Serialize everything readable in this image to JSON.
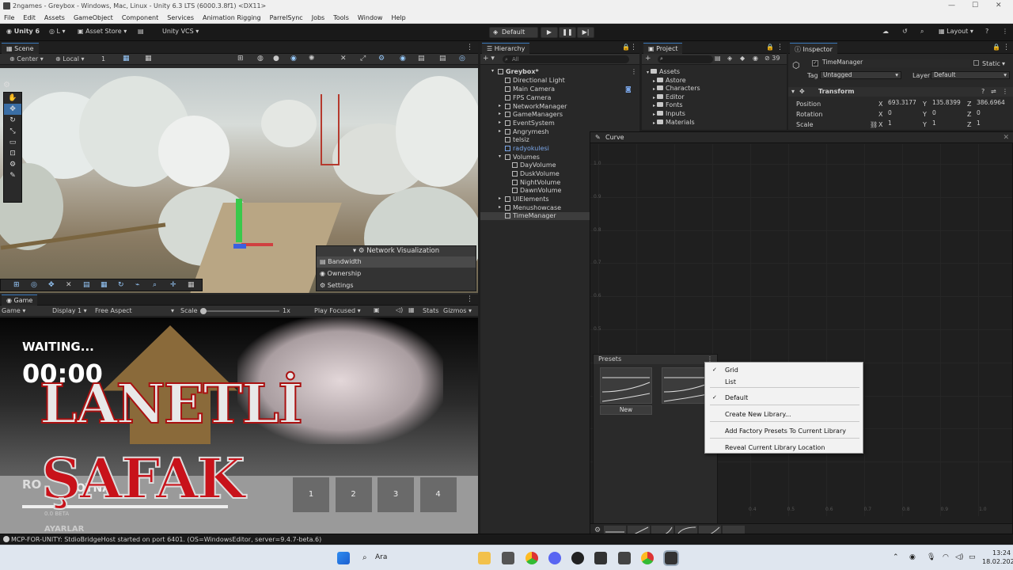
{
  "window": {
    "title": "2ngames - Greybox - Windows, Mac, Linux - Unity 6.3 LTS (6000.3.8f1) <DX11>",
    "minimize": "—",
    "maximize": "☐",
    "close": "✕"
  },
  "menu": [
    "File",
    "Edit",
    "Assets",
    "GameObject",
    "Component",
    "Services",
    "Animation Rigging",
    "ParrelSync",
    "Jobs",
    "Tools",
    "Window",
    "Help"
  ],
  "toolbar": {
    "unity_label": "Unity 6",
    "account": "L",
    "asset_store": "Asset Store",
    "vcs": "Unity VCS",
    "default_label": "Default",
    "layout": "Layout"
  },
  "scene": {
    "tab": "Scene",
    "pivot": "Center",
    "space": "Local",
    "snap_value": "1",
    "overlay": {
      "title": "Network Visualization",
      "items": [
        "Bandwidth",
        "Ownership",
        "Settings"
      ]
    }
  },
  "game": {
    "tab": "Game",
    "mode": "Game",
    "display": "Display 1",
    "aspect": "Free Aspect",
    "scale_label": "Scale",
    "scale_value": "1x",
    "play_mode": "Play Focused",
    "stats": "Stats",
    "gizmos": "Gizmos",
    "waiting": "WAITING...",
    "timer": "00:00",
    "title_line1": "LANETLİ",
    "title_line2": "ŞAFAK",
    "play": "OYNA",
    "role_partial": "RO",
    "settings_partial": "AYARLAR",
    "version_partial": "0.0 BETA",
    "buttons": [
      "1",
      "2",
      "3",
      "4"
    ]
  },
  "hierarchy": {
    "tab": "Hierarchy",
    "search_placeholder": "All",
    "items": [
      {
        "label": "Greybox*",
        "depth": 0
      },
      {
        "label": "Directional Light",
        "depth": 1
      },
      {
        "label": "Main Camera",
        "depth": 1
      },
      {
        "label": "FPS Camera",
        "depth": 1
      },
      {
        "label": "NetworkManager",
        "depth": 1
      },
      {
        "label": "GameManagers",
        "depth": 1
      },
      {
        "label": "EventSystem",
        "depth": 1
      },
      {
        "label": "Angrymesh",
        "depth": 1
      },
      {
        "label": "telsiz",
        "depth": 1
      },
      {
        "label": "radyokulesi",
        "depth": 1
      },
      {
        "label": "Volumes",
        "depth": 1
      },
      {
        "label": "DayVolume",
        "depth": 2
      },
      {
        "label": "DuskVolume",
        "depth": 2
      },
      {
        "label": "NightVolume",
        "depth": 2
      },
      {
        "label": "DawnVolume",
        "depth": 2
      },
      {
        "label": "UIElements",
        "depth": 1
      },
      {
        "label": "Menushowcase",
        "depth": 1
      },
      {
        "label": "TimeManager",
        "depth": 1
      }
    ]
  },
  "project": {
    "tab": "Project",
    "count": "39",
    "items": [
      "Assets",
      "Astore",
      "Characters",
      "Editor",
      "Fonts",
      "Inputs",
      "Materials"
    ]
  },
  "inspector": {
    "tab": "Inspector",
    "object_name": "TimeManager",
    "static": "Static",
    "tag_label": "Tag",
    "tag_value": "Untagged",
    "layer_label": "Layer",
    "layer_value": "Default",
    "component": "Transform",
    "position_label": "Position",
    "rotation_label": "Rotation",
    "scale_label": "Scale",
    "position": {
      "x": "693.3177",
      "y": "135.8399",
      "z": "386.6964"
    },
    "rotation": {
      "x": "0",
      "y": "0",
      "z": "0"
    },
    "scale": {
      "x": "1",
      "y": "1",
      "z": "1"
    },
    "axis": {
      "x": "X",
      "y": "Y",
      "z": "Z"
    }
  },
  "curve": {
    "title": "Curve",
    "y_ticks": [
      "1.0",
      "0.9",
      "0.8",
      "0.7",
      "0.6",
      "0.5",
      "0.4",
      "0.3",
      "0.2",
      "0.1"
    ],
    "x_ticks": [
      "0.4",
      "0.5",
      "0.6",
      "0.7",
      "0.8",
      "0.9",
      "1.0"
    ],
    "presets_title": "Presets",
    "new_label": "New"
  },
  "context_menu": {
    "items": [
      {
        "label": "Grid",
        "checked": true
      },
      {
        "label": "List",
        "checked": false
      },
      {
        "label": "Default",
        "checked": true
      },
      {
        "label": "Create New Library...",
        "checked": false
      },
      {
        "label": "Add Factory Presets To Current Library",
        "checked": false
      },
      {
        "label": "Reveal Current Library Location",
        "checked": false
      }
    ],
    "check_glyph": "✓"
  },
  "status": {
    "text": "MCP-FOR-UNITY: StdioBridgeHost started on port 6401. (OS=WindowsEditor, server=9.4.7-beta.6)"
  },
  "taskbar": {
    "search": "Ara",
    "time": "13:24",
    "date": "18.02.2026"
  }
}
